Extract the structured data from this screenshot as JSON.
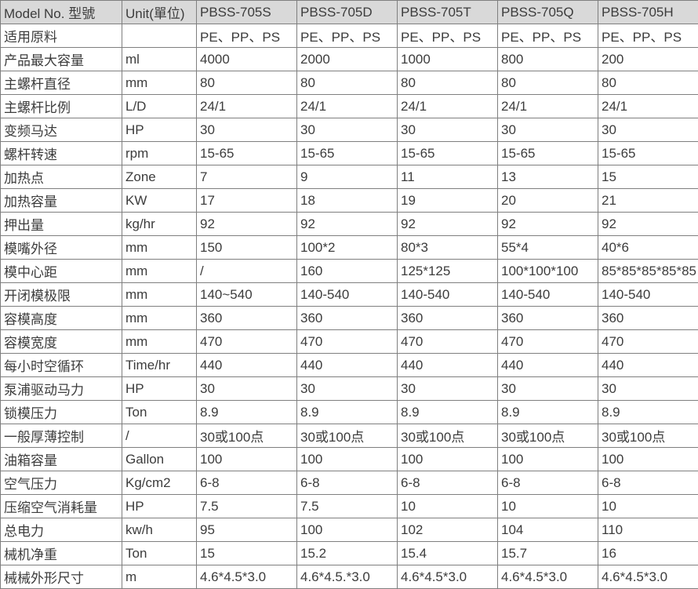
{
  "headers": [
    "Model No. 型號",
    "Unit(單位)",
    "PBSS-705S",
    "PBSS-705D",
    "PBSS-705T",
    "PBSS-705Q",
    "PBSS-705H"
  ],
  "rows": [
    {
      "label": "适用原料",
      "unit": "",
      "vals": [
        "PE、PP、PS",
        "PE、PP、PS",
        "PE、PP、PS",
        "PE、PP、PS",
        "PE、PP、PS"
      ]
    },
    {
      "label": "产品最大容量",
      "unit": "ml",
      "vals": [
        "4000",
        "2000",
        "1000",
        "800",
        "200"
      ]
    },
    {
      "label": "主螺杆直径",
      "unit": "mm",
      "vals": [
        "80",
        "80",
        "80",
        "80",
        "80"
      ]
    },
    {
      "label": "主螺杆比例",
      "unit": "L/D",
      "vals": [
        "24/1",
        "24/1",
        "24/1",
        "24/1",
        "24/1"
      ]
    },
    {
      "label": "变频马达",
      "unit": "HP",
      "vals": [
        "30",
        "30",
        "30",
        "30",
        "30"
      ]
    },
    {
      "label": "螺杆转速",
      "unit": "rpm",
      "vals": [
        "15-65",
        "15-65",
        "15-65",
        "15-65",
        "15-65"
      ]
    },
    {
      "label": "加热点",
      "unit": "Zone",
      "vals": [
        "7",
        "9",
        "11",
        "13",
        "15"
      ]
    },
    {
      "label": "加热容量",
      "unit": "KW",
      "vals": [
        "17",
        "18",
        "19",
        "20",
        "21"
      ]
    },
    {
      "label": "押出量",
      "unit": "kg/hr",
      "vals": [
        "92",
        "92",
        "92",
        "92",
        "92"
      ]
    },
    {
      "label": "模嘴外径",
      "unit": "mm",
      "vals": [
        "150",
        "100*2",
        "80*3",
        "55*4",
        "40*6"
      ]
    },
    {
      "label": "模中心距",
      "unit": "mm",
      "vals": [
        "/",
        "160",
        "125*125",
        "100*100*100",
        "85*85*85*85*85"
      ]
    },
    {
      "label": "开闭模极限",
      "unit": "mm",
      "vals": [
        "140~540",
        "140-540",
        "140-540",
        "140-540",
        "140-540"
      ]
    },
    {
      "label": "容模高度",
      "unit": "mm",
      "vals": [
        "360",
        "360",
        "360",
        "360",
        "360"
      ]
    },
    {
      "label": "容模宽度",
      "unit": "mm",
      "vals": [
        "470",
        "470",
        "470",
        "470",
        "470"
      ]
    },
    {
      "label": "每小时空循环",
      "unit": "Time/hr",
      "vals": [
        "440",
        "440",
        "440",
        "440",
        "440"
      ]
    },
    {
      "label": "泵浦驱动马力",
      "unit": "HP",
      "vals": [
        "30",
        "30",
        "30",
        "30",
        "30"
      ]
    },
    {
      "label": "锁模压力",
      "unit": "Ton",
      "vals": [
        "8.9",
        "8.9",
        "8.9",
        "8.9",
        "8.9"
      ]
    },
    {
      "label": "一般厚薄控制",
      "unit": "/",
      "vals": [
        "30或100点",
        "30或100点",
        "30或100点",
        "30或100点",
        "30或100点"
      ]
    },
    {
      "label": "油箱容量",
      "unit": "Gallon",
      "vals": [
        "100",
        "100",
        "100",
        "100",
        "100"
      ]
    },
    {
      "label": "空气压力",
      "unit": "Kg/cm2",
      "vals": [
        "6-8",
        "6-8",
        "6-8",
        "6-8",
        "6-8"
      ]
    },
    {
      "label": "压缩空气消耗量",
      "unit": "HP",
      "vals": [
        "7.5",
        "7.5",
        "10",
        "10",
        "10"
      ]
    },
    {
      "label": "总电力",
      "unit": "kw/h",
      "vals": [
        "95",
        "100",
        "102",
        "104",
        "110"
      ]
    },
    {
      "label": "械机净重",
      "unit": "Ton",
      "vals": [
        "15",
        "15.2",
        "15.4",
        "15.7",
        "16"
      ]
    },
    {
      "label": "械械外形尺寸",
      "unit": "m",
      "vals": [
        "4.6*4.5*3.0",
        "4.6*4.5.*3.0",
        "4.6*4.5*3.0",
        "4.6*4.5*3.0",
        "4.6*4.5*3.0"
      ]
    }
  ]
}
